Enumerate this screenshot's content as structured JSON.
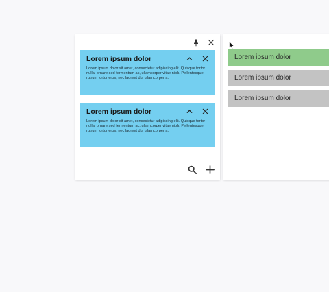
{
  "left_panel": {
    "header_icons": [
      "pin-icon",
      "close-icon"
    ],
    "cards": [
      {
        "title": "Lorem ipsum dolor",
        "body": "Lorem ipsum dolor sit amet, consectetur adipiscing elit. Quisque tortor nulla, ornare sed fermentum ac, ullamcorper vitae nibh. Pellentesque rutrum tortor eros, nec laoreet dui ullamcorper a.",
        "actions": [
          "chevron-up-icon",
          "close-icon"
        ]
      },
      {
        "title": "Lorem ipsum dolor",
        "body": "Lorem ipsum dolor sit amet, consectetur adipiscing elit. Quisque tortor nulla, ornare sed fermentum ac, ullamcorper vitae nibh. Pellentesque rutrum tortor eros, nec laoreet dui ullamcorper a.",
        "actions": [
          "chevron-up-icon",
          "close-icon"
        ]
      }
    ],
    "footer_icons": [
      "search-icon",
      "plus-icon"
    ],
    "card_color": "#74cff0"
  },
  "right_panel": {
    "items": [
      {
        "label": "Lorem ipsum dolor",
        "color": "#8fcb8b"
      },
      {
        "label": "Lorem ipsum dolor",
        "color": "#c3c3c3"
      },
      {
        "label": "Lorem ipsum dolor",
        "color": "#c3c3c3"
      }
    ]
  }
}
